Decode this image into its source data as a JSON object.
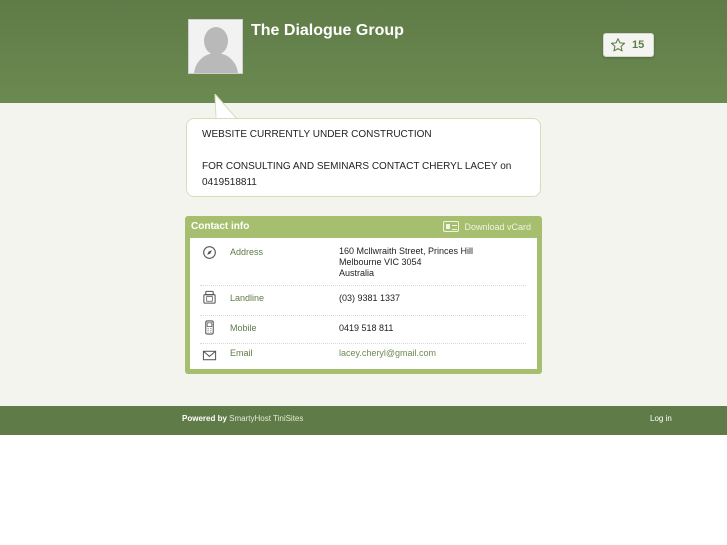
{
  "header": {
    "title": "The Dialogue Group",
    "star_count": "15",
    "accent_color": "#5f7b47"
  },
  "message": {
    "line1": "WEBSITE CURRENTLY UNDER CONSTRUCTION",
    "line2": "FOR CONSULTING AND SEMINARS CONTACT CHERYL LACEY on 0419518811"
  },
  "contact": {
    "heading": "Contact info",
    "vcard_label": "Download vCard",
    "rows": [
      {
        "icon": "compass-icon",
        "label": "Address",
        "value_lines": [
          "160 Mcllwraith Street, Princes Hill",
          "Melbourne VIC 3054",
          "Australia"
        ]
      },
      {
        "icon": "phone-icon",
        "label": "Landline",
        "value": "(03) 9381 1337"
      },
      {
        "icon": "mobile-icon",
        "label": "Mobile",
        "value": "0419 518 811"
      },
      {
        "icon": "envelope-icon",
        "label": "Email",
        "value": "lacey.cheryl@gmail.com"
      }
    ]
  },
  "footer": {
    "powered_by": "Powered by",
    "host": "SmartyHost TiniSites",
    "login": "Log in"
  }
}
